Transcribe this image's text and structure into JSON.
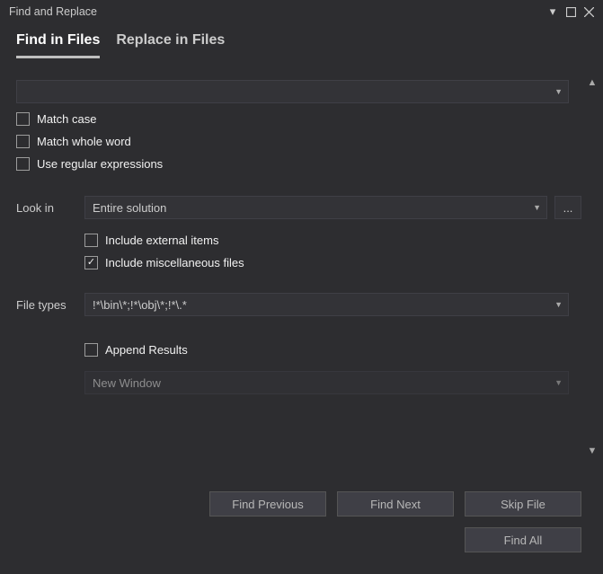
{
  "window": {
    "title": "Find and Replace"
  },
  "tabs": {
    "find": "Find in Files",
    "replace": "Replace in Files"
  },
  "search": {
    "value": ""
  },
  "options": {
    "match_case": "Match case",
    "match_whole_word": "Match whole word",
    "use_regex": "Use regular expressions"
  },
  "lookin": {
    "label": "Look in",
    "value": "Entire solution",
    "include_external": "Include external items",
    "include_misc": "Include miscellaneous files"
  },
  "filetypes": {
    "label": "File types",
    "value": "!*\\bin\\*;!*\\obj\\*;!*\\.*"
  },
  "results": {
    "append": "Append Results",
    "window": "New Window"
  },
  "buttons": {
    "find_previous": "Find Previous",
    "find_next": "Find Next",
    "skip_file": "Skip File",
    "find_all": "Find All"
  }
}
